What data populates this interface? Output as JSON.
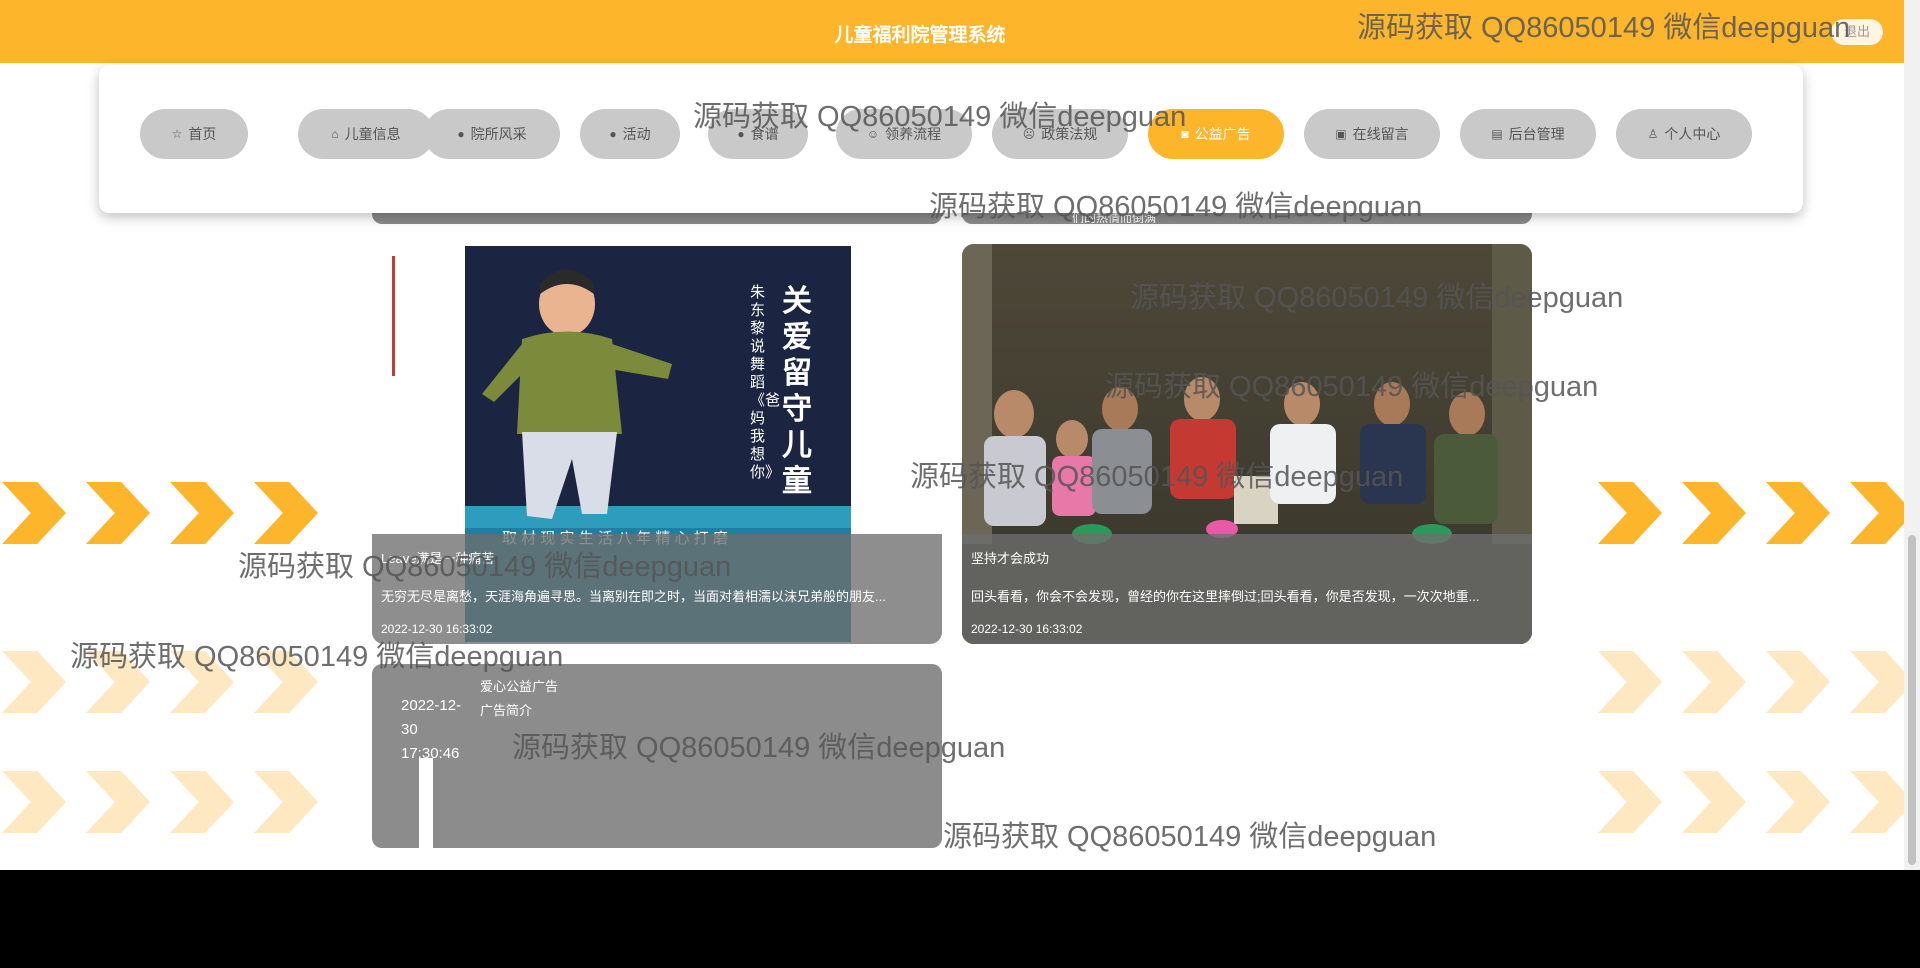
{
  "header": {
    "title": "儿童福利院管理系统",
    "logout_label": "退出",
    "brand_color": "#fdb52b"
  },
  "nav": {
    "items": [
      {
        "label": "首页",
        "icon": "☆",
        "icon_name": "star-icon"
      },
      {
        "label": "儿童信息",
        "icon": "⌂",
        "icon_name": "bag-icon"
      },
      {
        "label": "院所风采",
        "icon": "●",
        "icon_name": "info-icon"
      },
      {
        "label": "活动",
        "icon": "●",
        "icon_name": "help-icon"
      },
      {
        "label": "食谱",
        "icon": "●",
        "icon_name": "info-icon"
      },
      {
        "label": "领养流程",
        "icon": "☺",
        "icon_name": "smile-icon"
      },
      {
        "label": "政策法规",
        "icon": "☹",
        "icon_name": "frown-icon"
      },
      {
        "label": "公益广告",
        "icon": "◙",
        "icon_name": "camera-icon"
      },
      {
        "label": "在线留言",
        "icon": "▣",
        "icon_name": "bus-icon"
      },
      {
        "label": "后台管理",
        "icon": "▤",
        "icon_name": "briefcase-icon"
      },
      {
        "label": "个人中心",
        "icon": "♙",
        "icon_name": "user-icon"
      }
    ],
    "active_label": "公益广告"
  },
  "cards": [
    {
      "title": "Leave满是一种痛苦",
      "description": "无穷无尽是离愁，天涯海角遍寻思。当离别在即之时，当面对着相濡以沫兄弟般的朋友...",
      "time": "2022-12-30 16:33:02",
      "cover_text": {
        "title": "关爱留守儿童",
        "subtitle": "朱东黎说舞蹈《爸妈我想你》",
        "banner": "取 材 现 实 生 活      八 年 精 心 打 磨"
      }
    },
    {
      "title": "坚持才会成功",
      "description": "回头看看，你会不会发现，曾经的你在这里摔倒过;回头看看，你是否发现，一次次地重...",
      "time": "2022-12-30 16:33:02"
    }
  ],
  "text_card": {
    "date": "2022-12-30 17:30:46",
    "title": "爱心公益广告",
    "subtitle": "广告简介"
  },
  "partial_text": "们的热情而倒满",
  "watermark": "源码获取 QQ86050149 微信deepguan"
}
